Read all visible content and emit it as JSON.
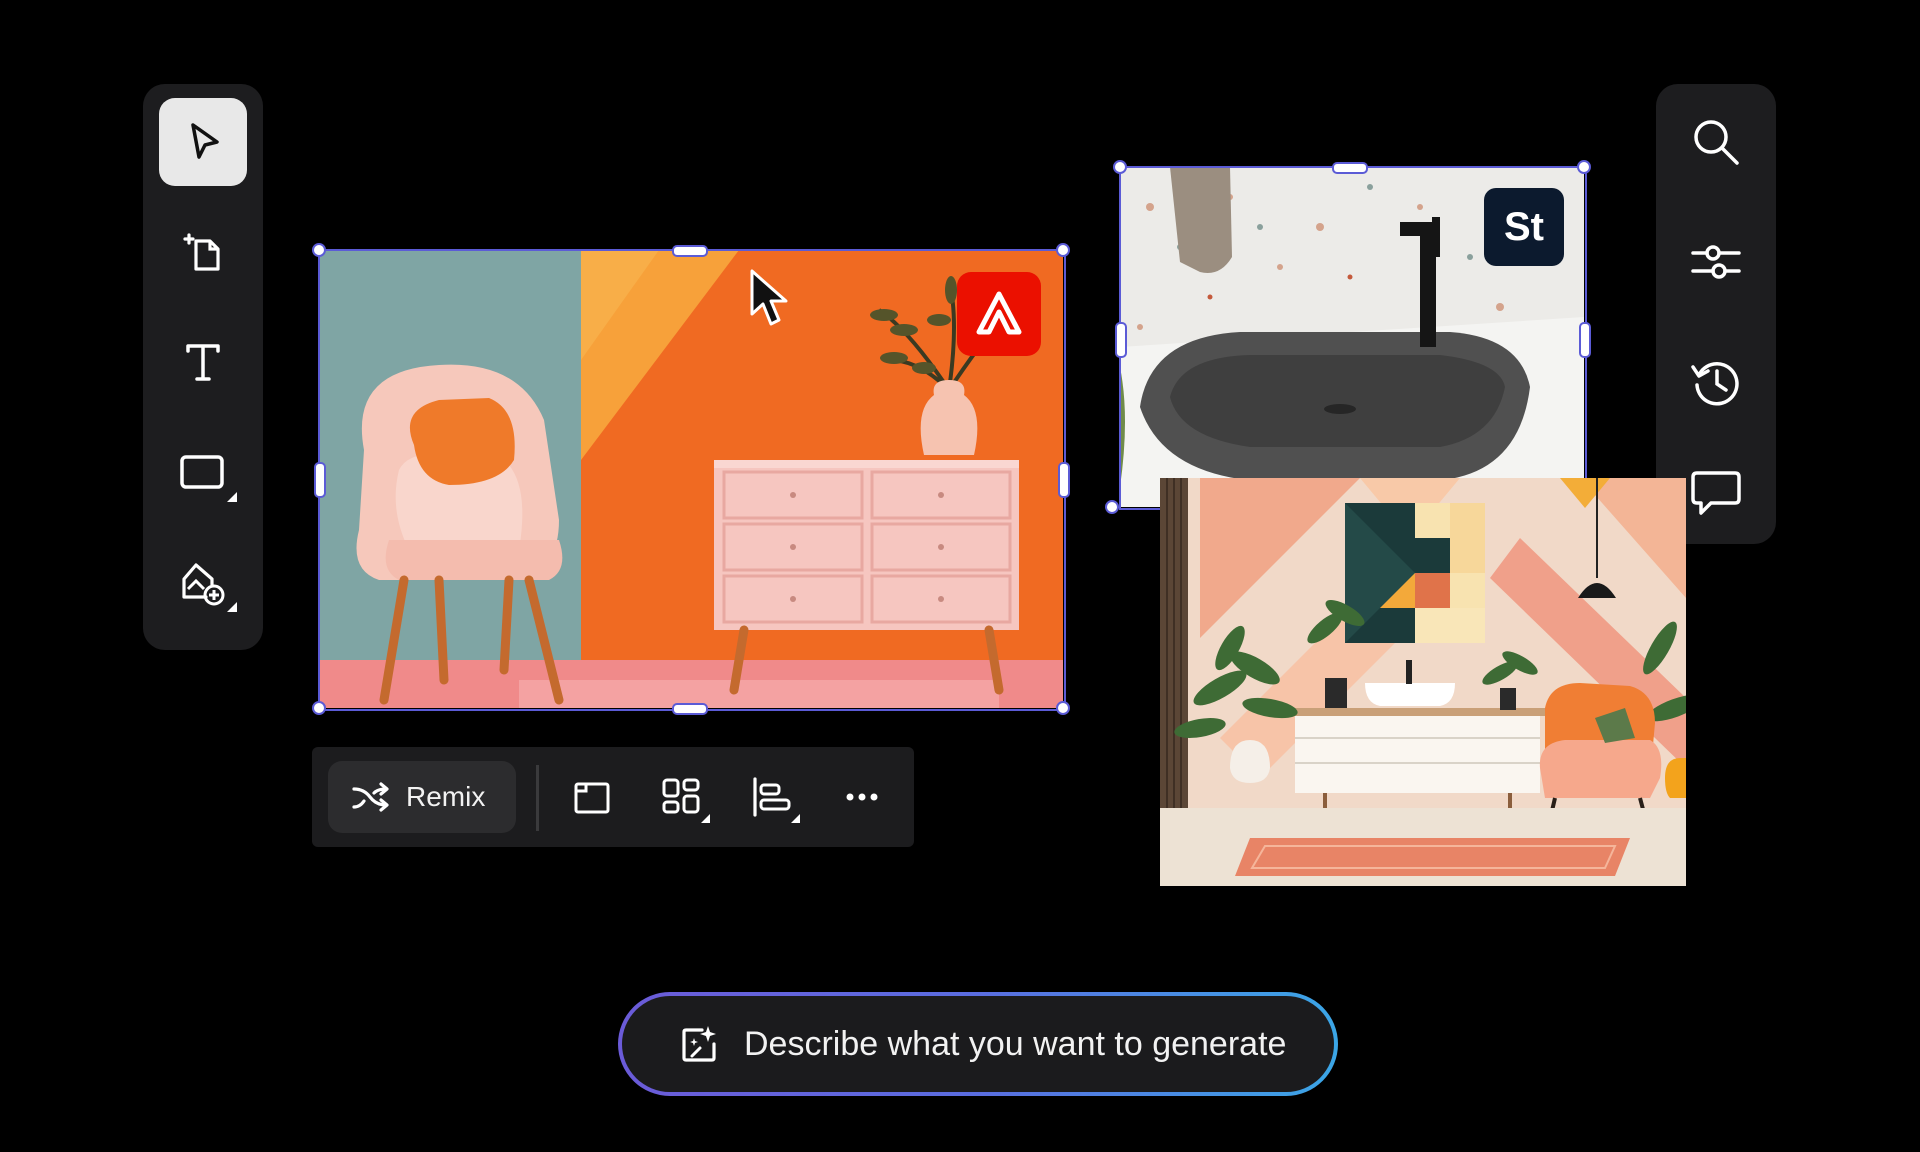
{
  "left_toolbar": {
    "tools": [
      {
        "name": "select-tool",
        "icon": "pointer-icon",
        "active": true
      },
      {
        "name": "add-page-tool",
        "icon": "add-page-icon"
      },
      {
        "name": "text-tool",
        "icon": "text-icon"
      },
      {
        "name": "shape-tool",
        "icon": "rectangle-icon"
      },
      {
        "name": "add-image-tool",
        "icon": "add-image-icon"
      }
    ]
  },
  "right_toolbar": {
    "tools": [
      {
        "name": "search-tool",
        "icon": "search-icon"
      },
      {
        "name": "adjust-tool",
        "icon": "sliders-icon"
      },
      {
        "name": "history-tool",
        "icon": "history-icon"
      },
      {
        "name": "comment-tool",
        "icon": "comment-icon"
      }
    ]
  },
  "badges": {
    "adobe_express": {
      "label": "A",
      "color": "#eb1000"
    },
    "stock": {
      "label": "St",
      "color": "#0c1a2e"
    }
  },
  "context_bar": {
    "remix_label": "Remix",
    "buttons": [
      {
        "name": "crop-button",
        "icon": "frame-icon"
      },
      {
        "name": "layout-button",
        "icon": "grid-icon"
      },
      {
        "name": "align-button",
        "icon": "align-left-icon"
      },
      {
        "name": "more-button",
        "icon": "more-icon"
      }
    ]
  },
  "prompt": {
    "placeholder": "Describe what you want to generate"
  },
  "colors": {
    "selection": "#5b5bd6",
    "toolbar_bg": "#1d1d1f",
    "gradient_start": "#6b5bd8",
    "gradient_end": "#3ba6e6"
  }
}
